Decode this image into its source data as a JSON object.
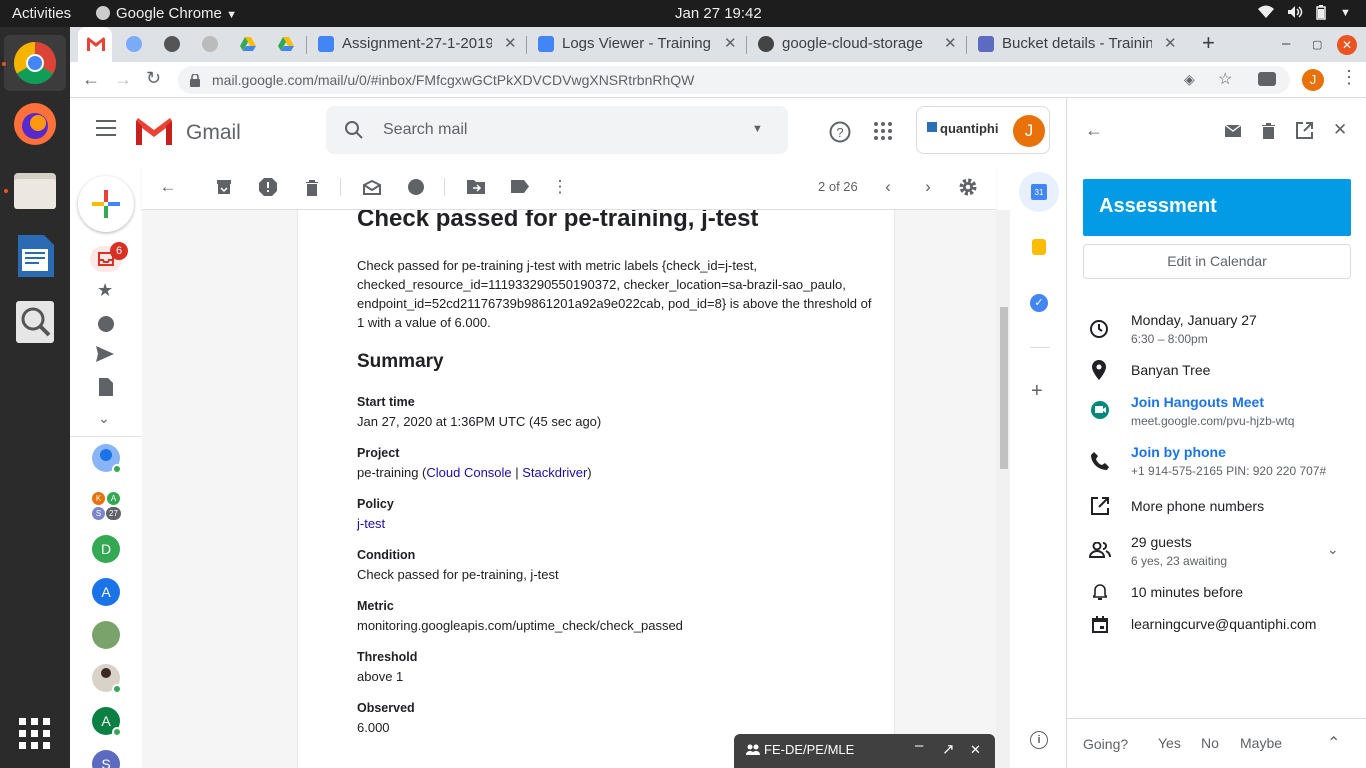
{
  "system": {
    "activities": "Activities",
    "app_name": "Google Chrome",
    "clock": "Jan 27  19:42"
  },
  "tabs": [
    {
      "label": "Assignment-27-1-2019"
    },
    {
      "label": "Logs Viewer - Training"
    },
    {
      "label": "google-cloud-storage"
    },
    {
      "label": "Bucket details - Trainin"
    }
  ],
  "browser": {
    "url": "mail.google.com/mail/u/0/#inbox/FMfcgxwGCtPkXDVCDVwgXNSRtrbnRhQW",
    "profile_initial": "J"
  },
  "gmail": {
    "logo_text": "Gmail",
    "search_placeholder": "Search mail",
    "org_name": "quantiphi",
    "avatar_initial": "J",
    "pagination": "2 of 26",
    "inbox_badge": "6",
    "hangouts_contacts": [
      {
        "initial": "D",
        "color": "#34a853"
      },
      {
        "initial": "A",
        "color": "#1a73e8"
      },
      {
        "initial": "A",
        "color": "#0b8043"
      },
      {
        "initial": "S",
        "color": "#5c6bc0"
      }
    ],
    "group_avatar": {
      "k": "K",
      "a": "A",
      "s": "S",
      "count": "27"
    }
  },
  "email": {
    "subject": "Check passed for pe-training, j-test",
    "body_lines": [
      "Check passed for pe-training j-test with metric labels {check_id=j-test,",
      "checked_resource_id=111933290550190372, checker_location=sa-brazil-sao_paulo,",
      "endpoint_id=52cd21176739b9861201a92a9e022cab, pod_id=8} is above the threshold of",
      "1 with a value of 6.000."
    ],
    "summary_heading": "Summary",
    "start_time_label": "Start time",
    "start_time_value": "Jan 27, 2020 at 1:36PM UTC (45 sec ago)",
    "project_label": "Project",
    "project_name": "pe-training (",
    "project_link1": "Cloud Console",
    "project_sep": " | ",
    "project_link2": "Stackdriver",
    "project_close": ")",
    "policy_label": "Policy",
    "policy_value": "j-test",
    "condition_label": "Condition",
    "condition_value": "Check passed for pe-training, j-test",
    "metric_label": "Metric",
    "metric_value": "monitoring.googleapis.com/uptime_check/check_passed",
    "threshold_label": "Threshold",
    "threshold_value": "above 1",
    "observed_label": "Observed",
    "observed_value": "6.000"
  },
  "event": {
    "title": "Assessment",
    "edit_button": "Edit in Calendar",
    "date": "Monday, January 27",
    "time": "6:30 – 8:00pm",
    "location": "Banyan Tree",
    "hangouts_link": "Join Hangouts Meet",
    "hangouts_url": "meet.google.com/pvu-hjzb-wtq",
    "phone_link": "Join by phone",
    "phone_number": "+1 914-575-2165 PIN: 920 220 707#",
    "more_phones": "More phone numbers",
    "guests": "29 guests",
    "guests_status": "6 yes, 23 awaiting",
    "reminder": "10 minutes before",
    "calendar": "learningcurve@quantiphi.com",
    "going_label": "Going?",
    "rsvp_yes": "Yes",
    "rsvp_no": "No",
    "rsvp_maybe": "Maybe"
  },
  "chat": {
    "title": "FE-DE/PE/MLE"
  },
  "colors": {
    "event_accent": "#039be5",
    "link": "#1a0dab",
    "gmail_red": "#ea4335",
    "avatar_orange": "#e8710a"
  }
}
